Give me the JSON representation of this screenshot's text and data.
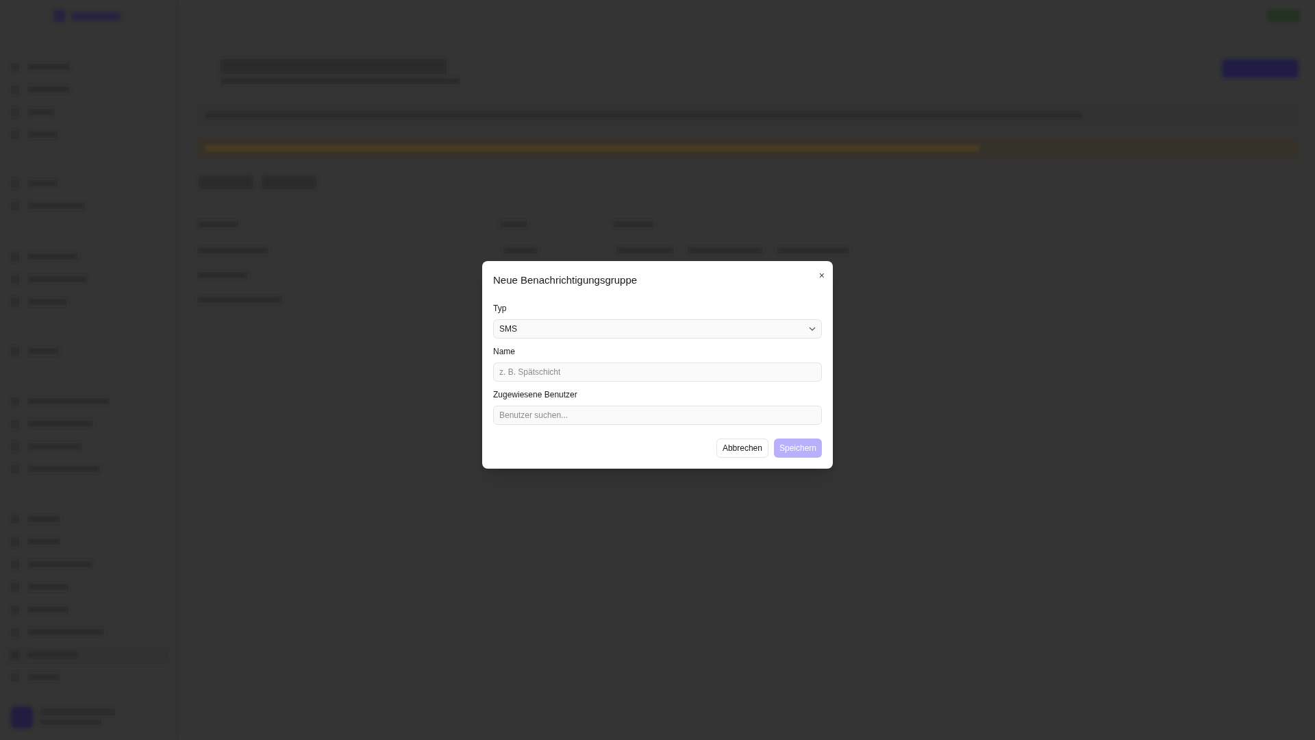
{
  "dialog": {
    "title": "Neue Benachrichtigungsgruppe",
    "close": "×",
    "fields": [
      {
        "kind": "select",
        "label": "Typ",
        "value": "SMS"
      },
      {
        "kind": "text",
        "label": "Name",
        "placeholder": "z. B. Spätschicht"
      },
      {
        "kind": "text",
        "label": "Zugewiesene Benutzer",
        "placeholder": "Benutzer suchen..."
      }
    ],
    "buttons": [
      {
        "kind": "secondary",
        "label": "Abbrechen",
        "disabled": false
      },
      {
        "kind": "primary",
        "label": "Speichern",
        "disabled": true
      }
    ]
  }
}
